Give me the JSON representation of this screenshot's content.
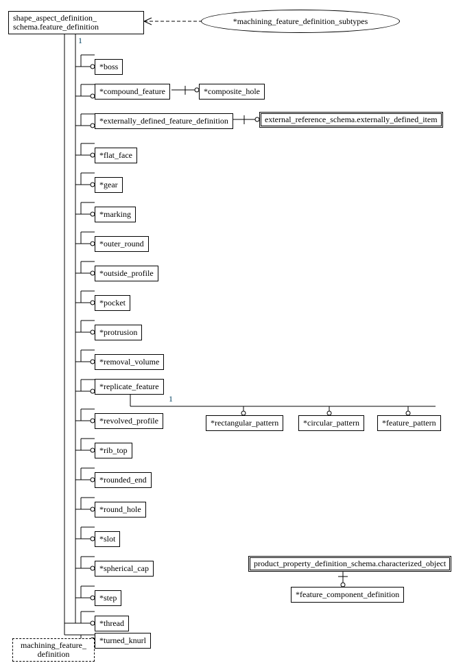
{
  "root": "shape_aspect_definition_\nschema.feature_definition",
  "subtypes_oval": "*machining_feature_definition_subtypes",
  "ext_item": "external_reference_schema.externally_defined_item",
  "bottom_dashed": "machining_feature_\ndefinition",
  "char_obj": "product_property_definition_schema.characterized_object",
  "feat_comp": "*feature_component_definition",
  "one_a": "1",
  "one_b": "1",
  "children": {
    "boss": "*boss",
    "compound_feature": "*compound_feature",
    "composite_hole": "*composite_hole",
    "ext_def": "*externally_defined_feature_definition",
    "flat_face": "*flat_face",
    "gear": "*gear",
    "marking": "*marking",
    "outer_round": "*outer_round",
    "outside_profile": "*outside_profile",
    "pocket": "*pocket",
    "protrusion": "*protrusion",
    "removal_volume": "*removal_volume",
    "replicate_feature": "*replicate_feature",
    "revolved_profile": "*revolved_profile",
    "rib_top": "*rib_top",
    "rounded_end": "*rounded_end",
    "round_hole": "*round_hole",
    "slot": "*slot",
    "spherical_cap": "*spherical_cap",
    "step": "*step",
    "thread": "*thread",
    "turned_knurl": "*turned_knurl"
  },
  "patterns": {
    "rect": "*rectangular_pattern",
    "circ": "*circular_pattern",
    "feat": "*feature_pattern"
  }
}
